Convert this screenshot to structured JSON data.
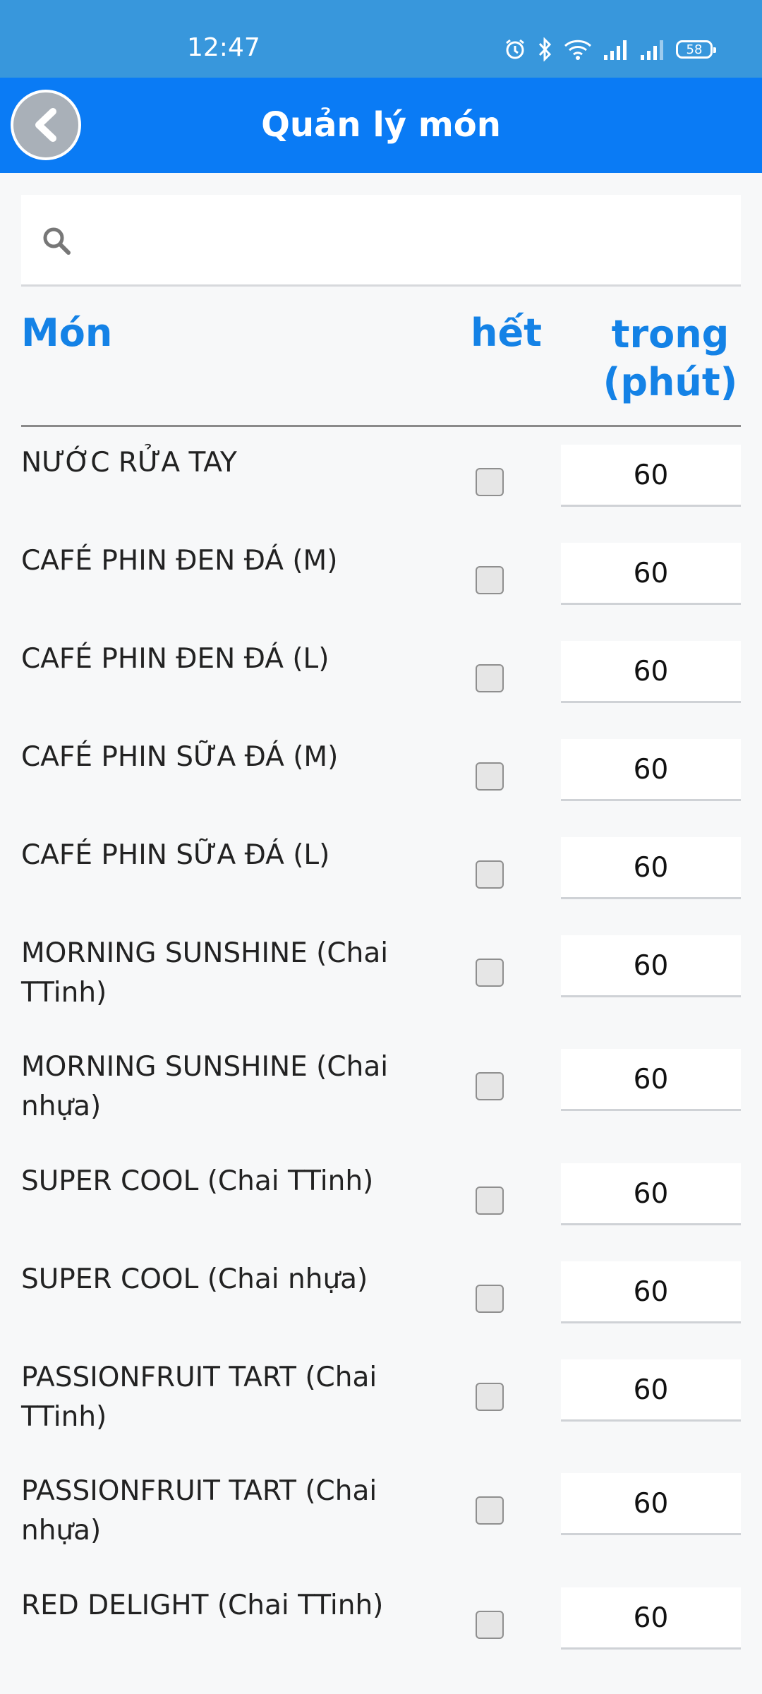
{
  "status_bar": {
    "time": "12:47",
    "battery": "58"
  },
  "header": {
    "title": "Quản lý món"
  },
  "search": {
    "placeholder": "",
    "value": ""
  },
  "columns": {
    "name": "Món",
    "out_of_stock": "hết",
    "time": "trong (phút)"
  },
  "items": [
    {
      "name": "NƯỚC RỬA TAY",
      "checked": false,
      "minutes": "60"
    },
    {
      "name": "CAFÉ PHIN ĐEN ĐÁ (M)",
      "checked": false,
      "minutes": "60"
    },
    {
      "name": "CAFÉ PHIN ĐEN ĐÁ (L)",
      "checked": false,
      "minutes": "60"
    },
    {
      "name": "CAFÉ PHIN SỮA ĐÁ (M)",
      "checked": false,
      "minutes": "60"
    },
    {
      "name": "CAFÉ PHIN SỮA ĐÁ (L)",
      "checked": false,
      "minutes": "60"
    },
    {
      "name": "MORNING SUNSHINE (Chai TTinh)",
      "checked": false,
      "minutes": "60"
    },
    {
      "name": "MORNING SUNSHINE (Chai nhựa)",
      "checked": false,
      "minutes": "60"
    },
    {
      "name": "SUPER COOL (Chai TTinh)",
      "checked": false,
      "minutes": "60"
    },
    {
      "name": "SUPER COOL (Chai nhựa)",
      "checked": false,
      "minutes": "60"
    },
    {
      "name": "PASSIONFRUIT TART (Chai TTinh)",
      "checked": false,
      "minutes": "60"
    },
    {
      "name": "PASSIONFRUIT TART (Chai nhựa)",
      "checked": false,
      "minutes": "60"
    },
    {
      "name": "RED DELIGHT (Chai TTinh)",
      "checked": false,
      "minutes": "60"
    }
  ]
}
